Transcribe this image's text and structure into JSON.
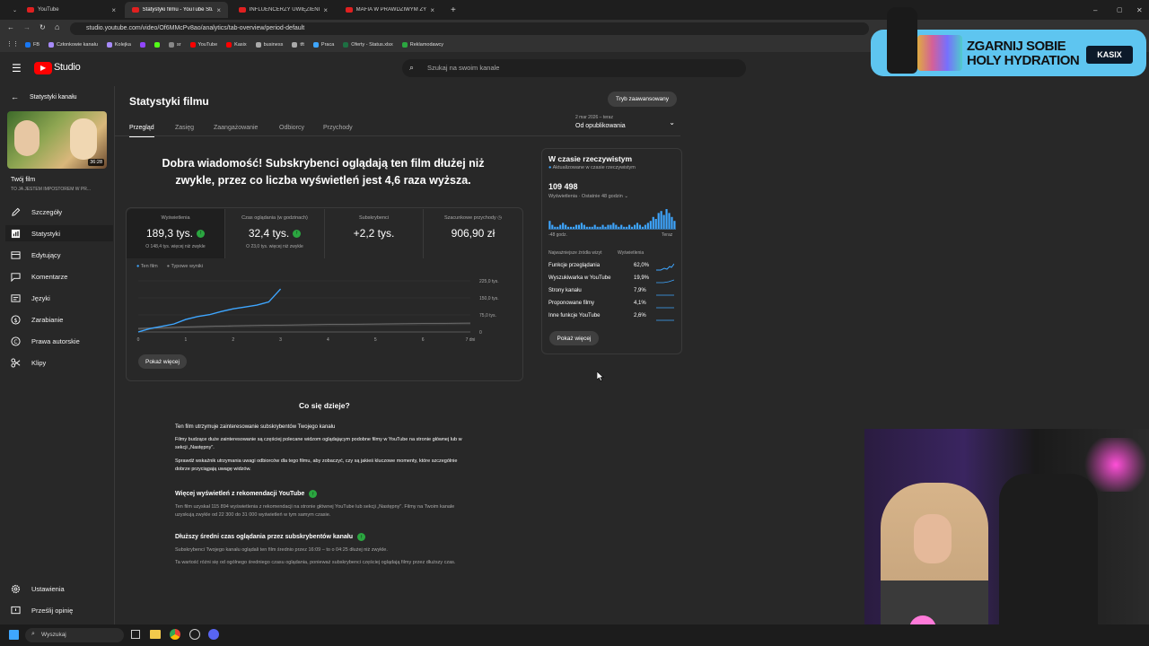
{
  "browser": {
    "tabs": [
      {
        "label": "YouTube"
      },
      {
        "label": "Statystyki filmu - YouTube Studio"
      },
      {
        "label": "INFLUENCERZY UWIĘZIENI W D"
      },
      {
        "label": "MAFIA W PRAWDZIWYM ŻYCIU"
      }
    ],
    "url": "studio.youtube.com/video/Of6MMcPv8ao/analytics/tab-overview/period-default",
    "bookmarks": [
      "FB",
      "Członkowie kanału",
      "Kolejka",
      "",
      "",
      "sr",
      "YouTube",
      "Kasix",
      "business",
      "tft",
      "Praca",
      "Oferty - Status.xlsx",
      "Reklamodawcy"
    ]
  },
  "studio": {
    "logo_text": "Studio",
    "search_placeholder": "Szukaj na swoim kanale"
  },
  "sidebar": {
    "back_label": "Statystyki kanału",
    "thumb_duration": "36:28",
    "film_label": "Twój film",
    "film_title": "TO JA JESTEM IMPOSTOREM W PR...",
    "items": [
      {
        "label": "Szczegóły",
        "icon": "pencil-icon"
      },
      {
        "label": "Statystyki",
        "icon": "analytics-icon"
      },
      {
        "label": "Edytujący",
        "icon": "editor-icon"
      },
      {
        "label": "Komentarze",
        "icon": "comment-icon"
      },
      {
        "label": "Języki",
        "icon": "subtitles-icon"
      },
      {
        "label": "Zarabianie",
        "icon": "dollar-icon"
      },
      {
        "label": "Prawa autorskie",
        "icon": "copyright-icon"
      },
      {
        "label": "Klipy",
        "icon": "scissors-icon"
      }
    ],
    "settings_label": "Ustawienia",
    "feedback_label": "Prześlij opinię"
  },
  "header": {
    "title": "Statystyki filmu",
    "advanced_button": "Tryb zaawansowany",
    "tabs": [
      "Przegląd",
      "Zasięg",
      "Zaangażowanie",
      "Odbiorcy",
      "Przychody"
    ],
    "date_range_top": "2 mar 2026 – teraz",
    "date_range_label": "Od opublikowania"
  },
  "overview": {
    "headline": "Dobra wiadomość! Subskrybenci oglądają ten film dłużej niż zwykle, przez co liczba wyświetleń jest 4,6 raza wyższa.",
    "metrics": [
      {
        "label": "Wyświetlenia",
        "value": "189,3 tys.",
        "sub": "O 148,4 tys. więcej niż zwykle",
        "up": true
      },
      {
        "label": "Czas oglądania (w godzinach)",
        "value": "32,4 tys.",
        "sub": "O 23,0 tys. więcej niż zwykle",
        "up": true
      },
      {
        "label": "Subskrybenci",
        "value": "+2,2 tys.",
        "sub": "",
        "up": false
      },
      {
        "label": "Szacunkowe przychody",
        "value": "906,90 zł",
        "sub": "",
        "up": false
      }
    ],
    "legend": [
      "Ten film",
      "Typowe wyniki"
    ],
    "show_more": "Pokaż więcej"
  },
  "chart_data": {
    "type": "line",
    "xlabel": "",
    "ylabel": "",
    "x_ticks": [
      "0",
      "1",
      "2",
      "3",
      "4",
      "5",
      "6",
      "7 dni"
    ],
    "y_ticks": [
      "225,0 tys.",
      "150,0 tys.",
      "75,0 tys.",
      "0"
    ],
    "ylim": [
      0,
      225000
    ],
    "xlim": [
      0,
      7
    ],
    "series": [
      {
        "name": "Ten film",
        "x": [
          0,
          0.25,
          0.5,
          0.75,
          1.0,
          1.25,
          1.5,
          1.75,
          2.0,
          2.25,
          2.5,
          2.75,
          3.0
        ],
        "values": [
          0,
          15000,
          25000,
          35000,
          55000,
          68000,
          76000,
          90000,
          102000,
          110000,
          118000,
          132000,
          189300
        ]
      },
      {
        "name": "Typowe wyniki",
        "x": [
          0,
          1,
          2,
          3,
          4,
          5,
          6,
          7
        ],
        "values": [
          15000,
          22000,
          27000,
          30000,
          33000,
          35000,
          37000,
          39000
        ]
      }
    ]
  },
  "realtime": {
    "title": "W czasie rzeczywistym",
    "status": "Aktualizowane w czasie rzeczywistym",
    "views": "109 498",
    "period": "Wyświetlenia · Ostatnie 48 godzin",
    "left_label": "-48 godz.",
    "right_label": "Teraz",
    "sources_header": "Najważniejsze źródła wizyt",
    "views_header": "Wyświetlenia",
    "sources": [
      {
        "name": "Funkcje przeglądania",
        "pct": "62,0%"
      },
      {
        "name": "Wyszukiwarka w YouTube",
        "pct": "19,9%"
      },
      {
        "name": "Strony kanału",
        "pct": "7,9%"
      },
      {
        "name": "Proponowane filmy",
        "pct": "4,1%"
      },
      {
        "name": "Inne funkcje YouTube",
        "pct": "2,6%"
      }
    ],
    "hourly_bars": [
      4,
      2,
      1,
      1,
      2,
      3,
      2,
      1,
      1,
      1,
      2,
      2,
      3,
      2,
      1,
      1,
      1,
      2,
      1,
      1,
      2,
      1,
      2,
      2,
      3,
      2,
      1,
      2,
      1,
      1,
      2,
      1,
      2,
      3,
      2,
      1,
      2,
      3,
      4,
      6,
      5,
      8,
      9,
      7,
      10,
      8,
      6,
      4
    ],
    "show_more": "Pokaż więcej"
  },
  "insights": {
    "title": "Co się dzieje?",
    "s1_heading": "Ten film utrzymuje zainteresowanie subskrybentów Twojego kanału",
    "s1_p1": "Filmy budzące duże zainteresowanie są częściej polecane widzom oglądającym podobne filmy w YouTube na stronie głównej lub w sekcji „Następny\".",
    "s1_p2": "Sprawdź wskaźnik utrzymania uwagi odbiorców dla tego filmu, aby zobaczyć, czy są jakieś kluczowe momenty, które szczególnie dobrze przyciągają uwagę widzów.",
    "s2_heading": "Więcej wyświetleń z rekomendacji YouTube",
    "s2_p1": "Ten film uzyskał 115 894 wyświetlenia z rekomendacji na stronie głównej YouTube lub sekcji „Następny\". Filmy na Twoim kanale uzyskują zwykle od 22 300 do 31 000 wyświetleń w tym samym czasie.",
    "s3_heading": "Dłuższy średni czas oglądania przez subskrybentów kanału",
    "s3_p1": "Subskrybenci Twojego kanału oglądali ten film średnio przez 16:09 – to o 04:25 dłużej niż zwykle.",
    "s3_p2": "Ta wartość różni się od ogólnego średniego czasu oglądania, ponieważ subskrybenci częściej oglądają filmy przez dłuższy czas."
  },
  "taskbar": {
    "search_label": "Wyszukaj"
  },
  "overlay_ad": {
    "line1": "ZGARNIJ SOBIE",
    "line2": "HOLY HYDRATION",
    "brand": "KASIX"
  },
  "colors": {
    "accent": "#3ea6ff",
    "positive": "#2ba640",
    "background": "#282828",
    "youtube_red": "#ff0000"
  }
}
